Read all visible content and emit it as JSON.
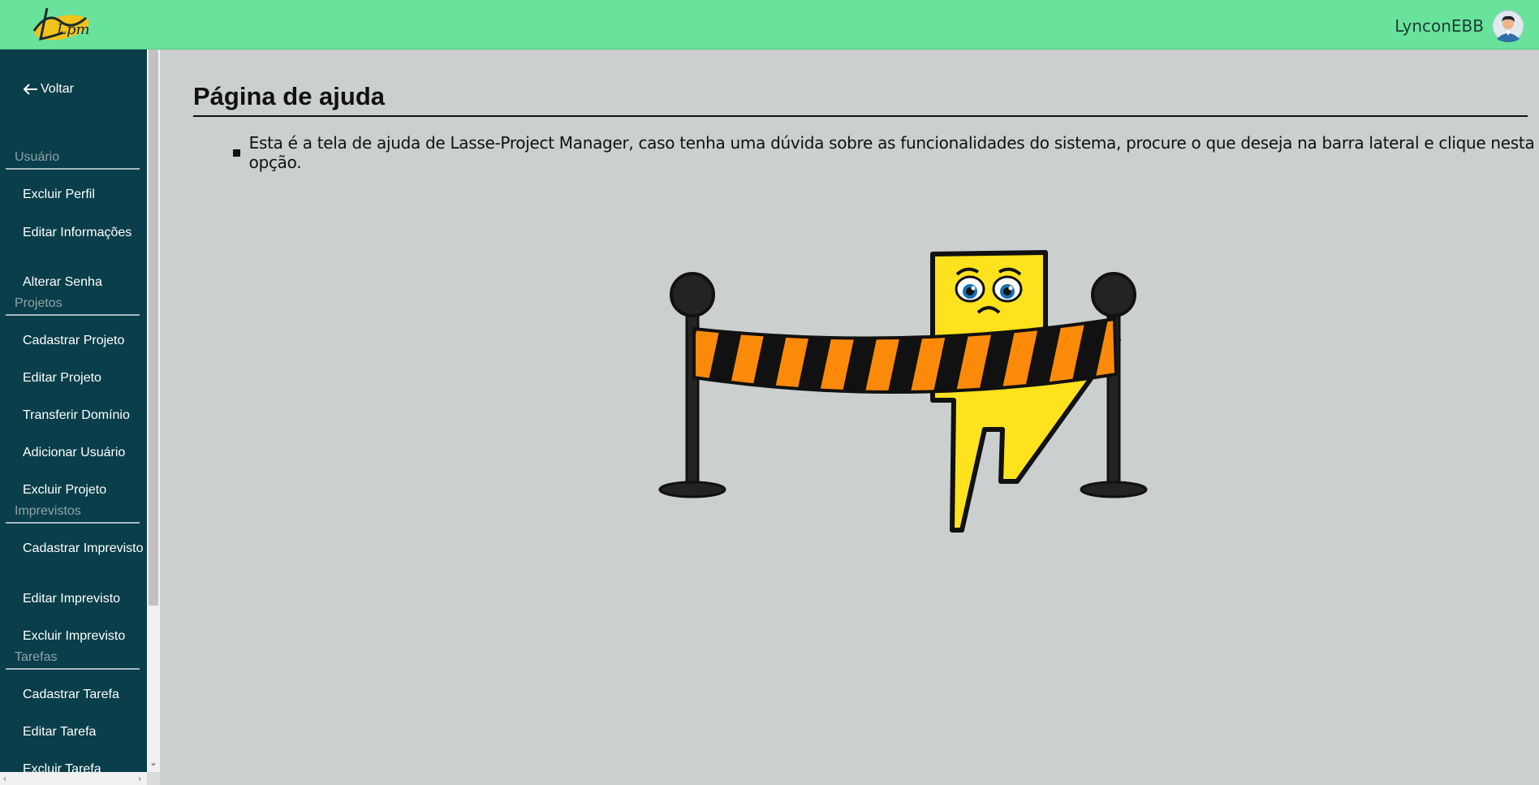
{
  "header": {
    "logo_text": "Lpm",
    "user_name": "LynconEBB"
  },
  "sidebar": {
    "back_label": "Voltar",
    "sections": [
      {
        "title": "Usuário",
        "items": [
          "Excluir Perfil",
          "Editar Informações",
          "Alterar Senha"
        ]
      },
      {
        "title": "Projetos",
        "items": [
          "Cadastrar Projeto",
          "Editar Projeto",
          "Transferir Domínio",
          "Adicionar Usuário",
          "Excluir Projeto"
        ]
      },
      {
        "title": "Imprevistos",
        "items": [
          "Cadastrar Imprevisto",
          "Editar Imprevisto",
          "Excluir Imprevisto"
        ]
      },
      {
        "title": "Tarefas",
        "items": [
          "Cadastrar Tarefa",
          "Editar Tarefa",
          "Excluir Tarefa"
        ]
      }
    ]
  },
  "main": {
    "title": "Página de ajuda",
    "help_text": "Esta é a tela de ajuda de Lasse-Project Manager, caso tenha uma dúvida sobre as funcionalidades do sistema, procure o que deseja na barra lateral e clique nesta opção."
  },
  "colors": {
    "header_bg": "#69e39b",
    "sidebar_bg": "#093e4a",
    "main_bg": "#cbcfd0",
    "mascot_yellow": "#fde21d",
    "tape_orange": "#fc8a0a"
  }
}
